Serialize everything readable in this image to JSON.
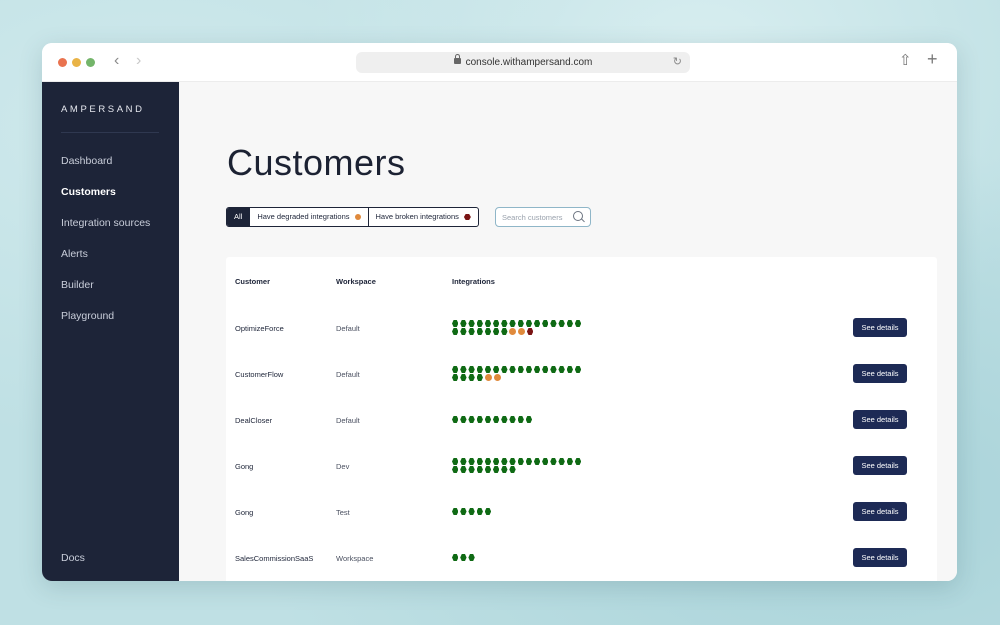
{
  "browser": {
    "url": "console.withampersand.com"
  },
  "sidebar": {
    "brand": "AMPERSAND",
    "items": [
      {
        "label": "Dashboard",
        "active": false
      },
      {
        "label": "Customers",
        "active": true
      },
      {
        "label": "Integration sources",
        "active": false
      },
      {
        "label": "Alerts",
        "active": false
      },
      {
        "label": "Builder",
        "active": false
      },
      {
        "label": "Playground",
        "active": false
      }
    ],
    "footer_items": [
      {
        "label": "Docs"
      }
    ]
  },
  "main": {
    "title": "Customers",
    "filters": [
      {
        "label": "All",
        "active": true
      },
      {
        "label": "Have degraded integrations",
        "indicator": "degraded"
      },
      {
        "label": "Have broken integrations",
        "indicator": "broken"
      }
    ],
    "search": {
      "placeholder": "Search customers"
    },
    "table": {
      "headers": [
        "Customer",
        "Workspace",
        "Integrations"
      ],
      "action_label": "See details",
      "rows": [
        {
          "customer": "OptimizeForce",
          "workspace": "Default",
          "healthy": 23,
          "degraded": 2,
          "broken": 1
        },
        {
          "customer": "CustomerFlow",
          "workspace": "Default",
          "healthy": 20,
          "degraded": 2,
          "broken": 0
        },
        {
          "customer": "DealCloser",
          "workspace": "Default",
          "healthy": 10,
          "degraded": 0,
          "broken": 0
        },
        {
          "customer": "Gong",
          "workspace": "Dev",
          "healthy": 24,
          "degraded": 0,
          "broken": 0
        },
        {
          "customer": "Gong",
          "workspace": "Test",
          "healthy": 5,
          "degraded": 0,
          "broken": 0
        },
        {
          "customer": "SalesCommissionSaaS",
          "workspace": "Workspace",
          "healthy": 3,
          "degraded": 0,
          "broken": 0
        }
      ]
    }
  },
  "colors": {
    "healthy": "#0f6a14",
    "degraded": "#e08a3c",
    "broken": "#7a1414",
    "sidebar_bg": "#1d2438",
    "button_bg": "#1d2a55"
  }
}
